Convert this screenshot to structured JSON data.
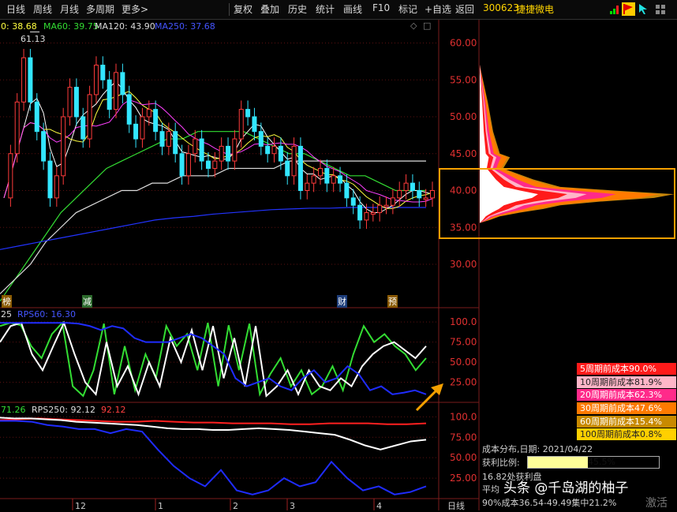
{
  "toolbar": {
    "left_tabs": [
      "日线",
      "周线",
      "月线",
      "多周期",
      "更多>"
    ],
    "right_tabs": [
      "复权",
      "叠加",
      "历史",
      "统计",
      "画线",
      "F10",
      "标记",
      "+自选",
      "返回"
    ],
    "stock_code": "300623",
    "stock_name": "捷捷微电",
    "icons": [
      "signal-bars-icon",
      "flag-icon",
      "arrow-cursor-icon",
      "grid-icon"
    ]
  },
  "indicators": {
    "ma30_partial": "0: 38.68",
    "ma60": "MA60: 39.75",
    "ma120": "MA120: 43.90",
    "ma250": "MA250: 37.68",
    "rps_mid_prefix": "25",
    "rps60": "RPS60: 16.30",
    "rps_low_prefix": "71.26",
    "rps250": "RPS250: 92.12",
    "rps250_red": "92.12"
  },
  "markers": [
    "榜",
    "减",
    "财",
    "预"
  ],
  "high_label": "61.13",
  "colors": {
    "bull": "#ff3b3b",
    "bear": "#33e6ff",
    "ma_short": "#ffffff",
    "ma_yellow": "#ffff40",
    "ma_magenta": "#ff40ff",
    "ma60": "#33dd33",
    "ma120": "#dddddd",
    "ma250": "#2233ff",
    "highlight": "#f5a000"
  },
  "chart_data": [
    {
      "type": "candlestick",
      "y_axis_ticks": [
        60.0,
        55.0,
        50.0,
        45.0,
        40.0,
        35.0,
        30.0
      ],
      "ylim": [
        26,
        64
      ],
      "x_ticks": [
        "12",
        "1",
        "2",
        "3",
        "4"
      ],
      "high_annotation": 61.13,
      "price_series": [
        39,
        45,
        52,
        58,
        52,
        48,
        44,
        39,
        42,
        50,
        54,
        50,
        47,
        53,
        57,
        55,
        51,
        56,
        53,
        49,
        47,
        50,
        51,
        48,
        46,
        48,
        45,
        42,
        45,
        47,
        44,
        43,
        44,
        46,
        44,
        47,
        51,
        50,
        48,
        46,
        45,
        46,
        44,
        42,
        46,
        40,
        41,
        42,
        43,
        41,
        42,
        41,
        39,
        38,
        36,
        37,
        37,
        38,
        38,
        39,
        40,
        41,
        40,
        39,
        39,
        40
      ],
      "series": [
        {
          "name": "MA60",
          "values": [
            25,
            28,
            31,
            34,
            37,
            39,
            41,
            43,
            44,
            45,
            46,
            47,
            47,
            48,
            48,
            48,
            48,
            47,
            46,
            45,
            45,
            44,
            43,
            42,
            42,
            41,
            40,
            40,
            40
          ]
        },
        {
          "name": "MA120",
          "values": [
            26,
            28,
            30,
            33,
            35,
            37,
            38,
            39,
            40,
            40,
            41,
            41,
            42,
            42,
            42,
            43,
            43,
            43,
            43,
            44,
            44,
            44,
            44,
            44,
            44,
            44,
            44,
            44,
            44
          ]
        },
        {
          "name": "MA250",
          "values": [
            32,
            32.5,
            33,
            33.5,
            34,
            34.5,
            35,
            35.5,
            36,
            36.3,
            36.5,
            36.8,
            37,
            37.2,
            37.4,
            37.5,
            37.6,
            37.6,
            37.7,
            37.7,
            37.7,
            37.7,
            37.7
          ]
        }
      ]
    },
    {
      "type": "area",
      "title": "成本分布",
      "ylim": [
        26,
        64
      ],
      "series": [
        {
          "name": "5周期前成本",
          "value": "90.0%"
        },
        {
          "name": "10周期前成本",
          "value": "81.9%"
        },
        {
          "name": "20周期前成本",
          "value": "62.3%"
        },
        {
          "name": "30周期前成本",
          "value": "47.6%"
        },
        {
          "name": "60周期前成本",
          "value": "15.4%"
        },
        {
          "name": "100周期前成本",
          "value": "0.8%"
        }
      ],
      "profile_price": [
        57,
        52,
        48,
        45,
        44.5,
        43,
        41.5,
        40.5,
        40,
        39.5,
        39,
        38.5,
        38,
        37.5,
        37,
        36.5,
        36,
        35.6
      ],
      "profile_width": [
        0,
        12,
        20,
        30,
        45,
        35,
        80,
        120,
        200,
        290,
        260,
        180,
        120,
        95,
        60,
        30,
        15,
        0
      ]
    },
    {
      "type": "line",
      "title": "RPS60",
      "y_ticks": [
        100.0,
        75.0,
        50.0,
        25.0
      ],
      "ylim": [
        0,
        110
      ],
      "series": [
        {
          "name": "RPS60",
          "values": [
            95,
            99,
            96,
            70,
            55,
            85,
            99,
            20,
            8,
            40,
            98,
            10,
            70,
            15,
            60,
            30,
            95,
            70,
            85,
            40,
            99,
            20,
            96,
            40,
            98,
            10,
            35,
            55,
            20,
            40,
            10,
            20,
            45,
            15,
            60,
            95,
            75,
            85,
            70,
            60,
            40,
            55
          ]
        },
        {
          "name": "RPS250",
          "values": [
            75,
            95,
            99,
            60,
            40,
            70,
            99,
            60,
            25,
            10,
            75,
            20,
            45,
            10,
            50,
            20,
            80,
            50,
            90,
            40,
            95,
            30,
            80,
            20,
            95,
            8,
            20,
            40,
            10,
            40,
            20,
            15,
            30,
            20,
            45,
            60,
            70,
            75,
            65,
            55,
            70
          ]
        },
        {
          "name": "RPS120",
          "values": [
            99,
            99,
            99,
            99,
            99,
            99,
            99,
            98,
            95,
            90,
            95,
            92,
            80,
            75,
            75,
            75,
            80,
            85,
            80,
            70,
            60,
            30,
            20,
            25,
            30,
            20,
            15,
            30,
            40,
            25,
            30,
            45,
            35,
            15,
            20,
            10,
            12,
            15,
            10
          ]
        }
      ]
    },
    {
      "type": "line",
      "title": "RPS250",
      "y_ticks": [
        100.0,
        75.0,
        50.0,
        25.0
      ],
      "ylim": [
        0,
        110
      ],
      "series": [
        {
          "name": "RPS250",
          "values": [
            96,
            97,
            98,
            97,
            96,
            95,
            94,
            94,
            95,
            94,
            93,
            93,
            92,
            92,
            92,
            91,
            91,
            92,
            92,
            92,
            91,
            91,
            92
          ]
        },
        {
          "name": "RPS120",
          "values": [
            99,
            98,
            98,
            97,
            96,
            94,
            93,
            92,
            91,
            90,
            88,
            86,
            85,
            85,
            84,
            84,
            85,
            86,
            85,
            84,
            82,
            80,
            78,
            72,
            65,
            60,
            65,
            70,
            72
          ]
        },
        {
          "name": "RPS60",
          "values": [
            95,
            95,
            94,
            90,
            88,
            85,
            85,
            80,
            85,
            82,
            60,
            40,
            25,
            15,
            35,
            10,
            5,
            10,
            25,
            15,
            20,
            45,
            25,
            10,
            15,
            5,
            8,
            15
          ]
        }
      ]
    }
  ],
  "cost_info": {
    "date_label": "成本分布,日期: 2021/04/22",
    "profit_label": "获利比例:",
    "profit_value": "45.5%",
    "profit_fraction": 0.455,
    "price_partial": "16.82处获利盘",
    "avg_partial": "平均",
    "concentration": "90%成本36.54-49.49集中21.2%"
  },
  "x_axis_label": "日线",
  "watermark": "头条 @千岛湖的柚子",
  "activate_label": "激活"
}
